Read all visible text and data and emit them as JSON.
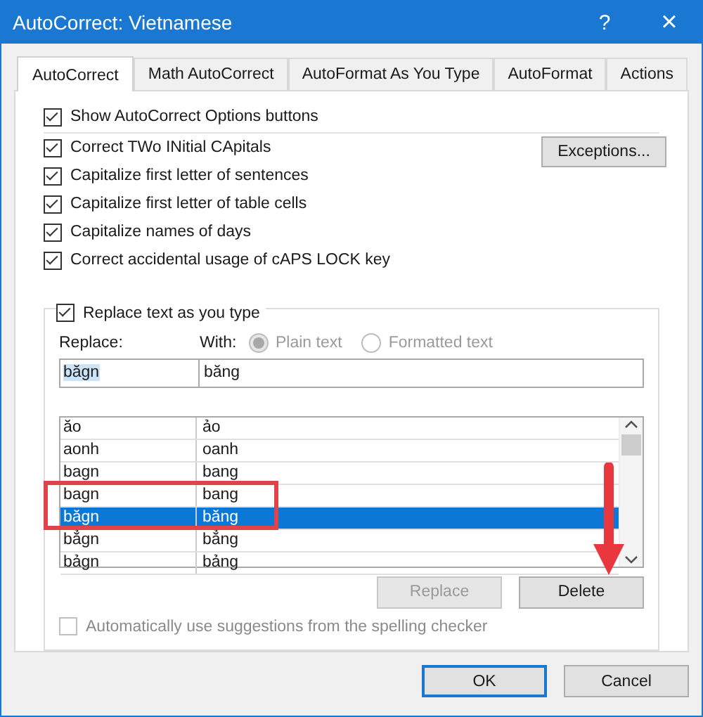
{
  "window": {
    "title": "AutoCorrect: Vietnamese",
    "help": "?",
    "close": "×"
  },
  "tabs": [
    {
      "label": "AutoCorrect",
      "selected": true
    },
    {
      "label": "Math AutoCorrect",
      "selected": false
    },
    {
      "label": "AutoFormat As You Type",
      "selected": false
    },
    {
      "label": "AutoFormat",
      "selected": false
    },
    {
      "label": "Actions",
      "selected": false
    }
  ],
  "top_option": {
    "label": "Show AutoCorrect Options buttons",
    "checked": true
  },
  "options": [
    {
      "label": "Correct TWo INitial CApitals",
      "checked": true
    },
    {
      "label": "Capitalize first letter of sentences",
      "checked": true
    },
    {
      "label": "Capitalize first letter of table cells",
      "checked": true
    },
    {
      "label": "Capitalize names of days",
      "checked": true
    },
    {
      "label": "Correct accidental usage of cAPS LOCK key",
      "checked": true
    }
  ],
  "exceptions_button": "Exceptions...",
  "replace_group": {
    "checkbox": {
      "label": "Replace text as you type",
      "checked": true
    },
    "replace_label": "Replace:",
    "with_label": "With:",
    "formats": [
      {
        "label": "Plain text",
        "selected": true,
        "disabled": true
      },
      {
        "label": "Formatted text",
        "selected": false,
        "disabled": true
      }
    ],
    "replace_value": "băgn",
    "with_value": "băng",
    "entries": [
      {
        "replace": "ăo",
        "with": "ảo",
        "selected": false
      },
      {
        "replace": "aonh",
        "with": "oanh",
        "selected": false
      },
      {
        "replace": "bagn",
        "with": "bang",
        "selected": false
      },
      {
        "replace": "bagn",
        "with": "bang",
        "selected": false
      },
      {
        "replace": "băgn",
        "with": "băng",
        "selected": true
      },
      {
        "replace": "bẳgn",
        "with": "bẳng",
        "selected": false
      },
      {
        "replace": "bảgn",
        "with": "bảng",
        "selected": false
      }
    ],
    "buttons": [
      {
        "label": "Replace",
        "disabled": true
      },
      {
        "label": "Delete",
        "disabled": false
      }
    ],
    "auto_suggest": {
      "label": "Automatically use suggestions from the spelling checker",
      "checked": false,
      "disabled": true
    }
  },
  "dialog_buttons": [
    {
      "label": "OK",
      "default": true
    },
    {
      "label": "Cancel",
      "default": false
    }
  ]
}
